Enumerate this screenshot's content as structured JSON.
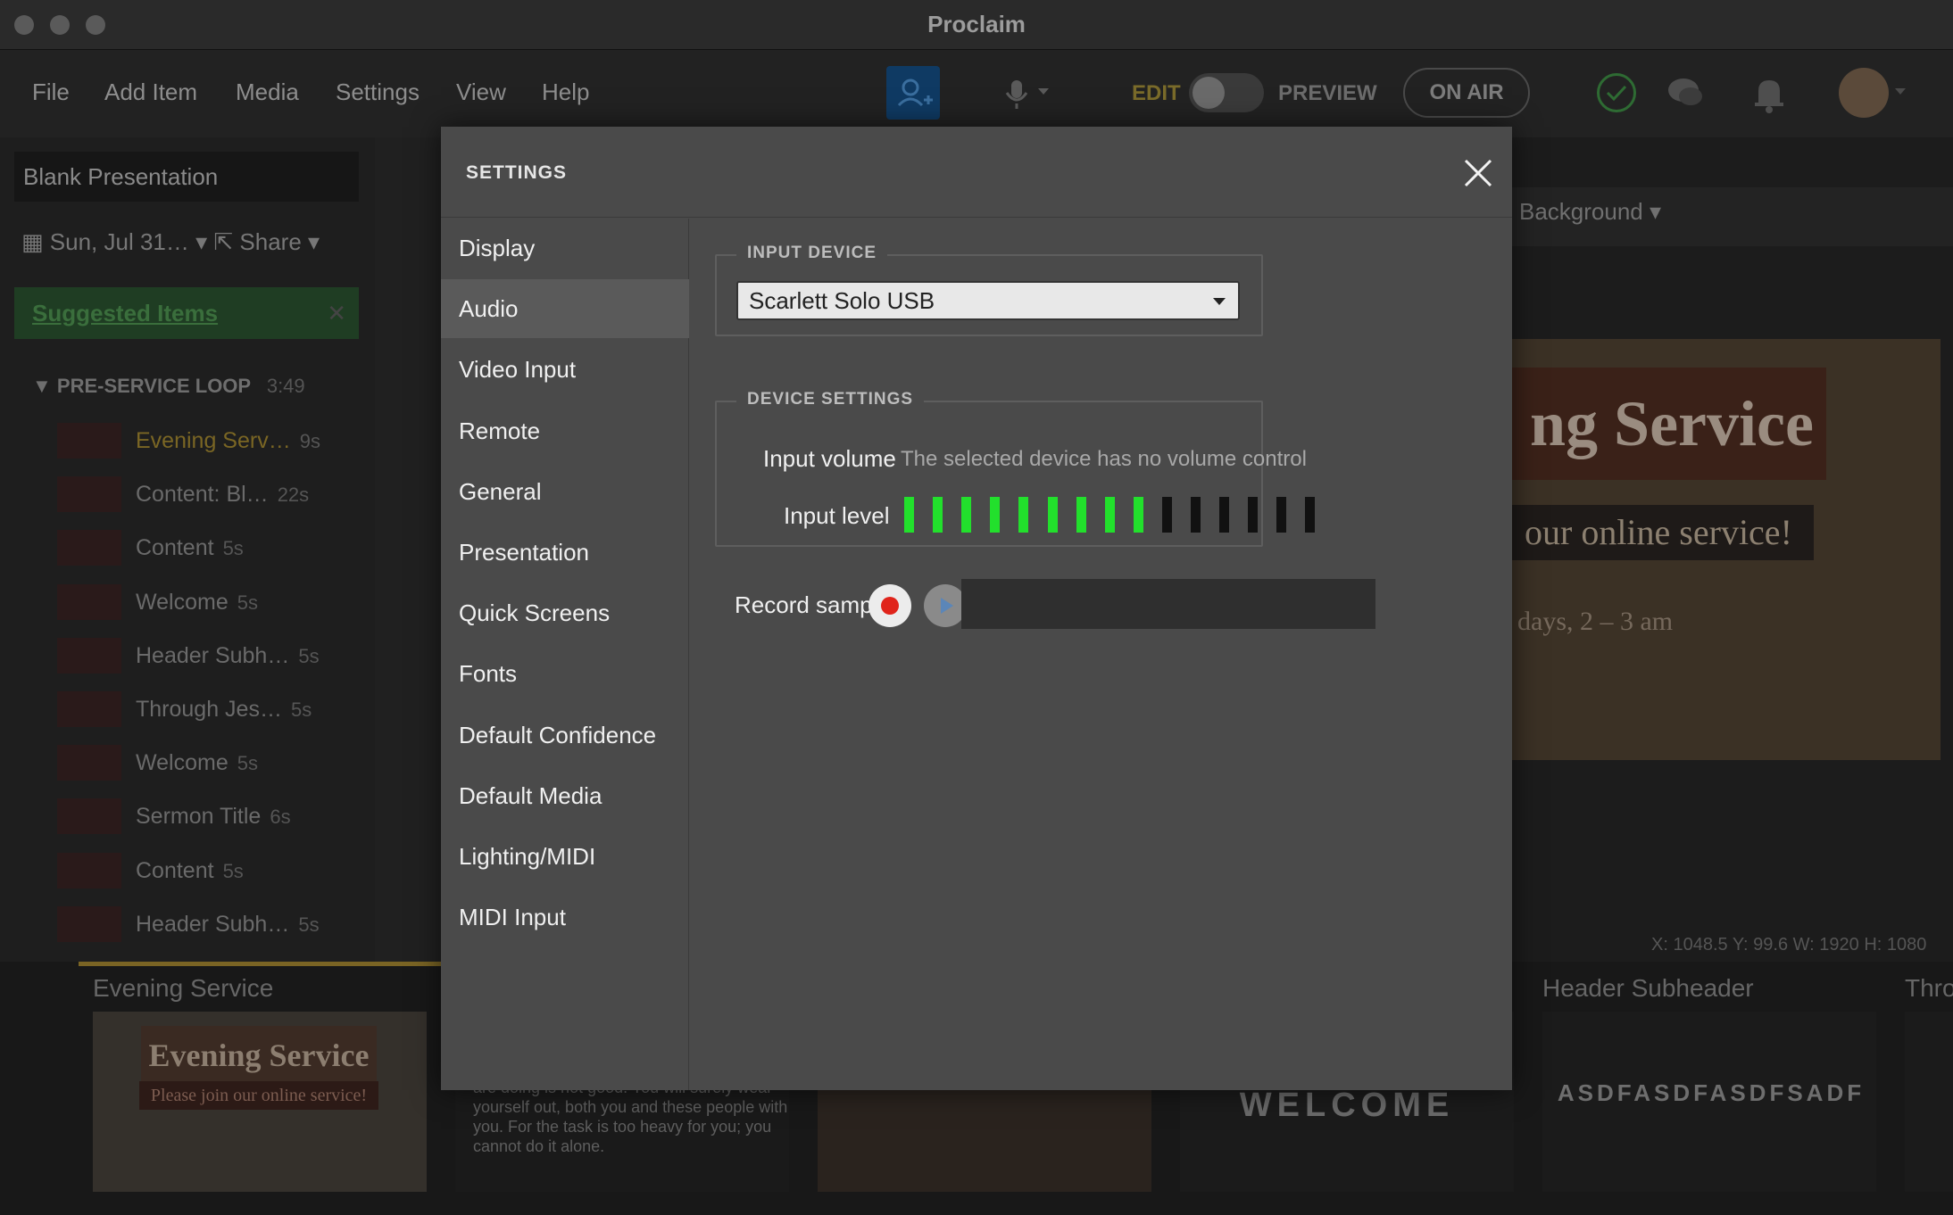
{
  "window": {
    "title": "Proclaim"
  },
  "menu": {
    "items": [
      "File",
      "Add Item",
      "Media",
      "Settings",
      "View",
      "Help"
    ],
    "edit_label": "EDIT",
    "preview_label": "PREVIEW",
    "onair_label": "ON AIR"
  },
  "background": {
    "presentation_name": "Blank Presentation",
    "date": "Sun, Jul 31…",
    "share": "Share",
    "suggested": "Suggested Items",
    "loop_title": "PRE-SERVICE LOOP",
    "loop_duration": "3:49",
    "items": [
      {
        "label": "Evening Serv…",
        "dur": "9s",
        "active": true
      },
      {
        "label": "Content: Bl…",
        "dur": "22s"
      },
      {
        "label": "Content",
        "dur": "5s"
      },
      {
        "label": "Welcome",
        "dur": "5s"
      },
      {
        "label": "Header Subh…",
        "dur": "5s"
      },
      {
        "label": "Through Jes…",
        "dur": "5s"
      },
      {
        "label": "Welcome",
        "dur": "5s"
      },
      {
        "label": "Sermon Title",
        "dur": "6s"
      },
      {
        "label": "Content",
        "dur": "5s"
      },
      {
        "label": "Header Subh…",
        "dur": "5s"
      }
    ],
    "toolbar_background": "Background",
    "preview_title": "ng Service",
    "preview_sub": "our online service!",
    "preview_day": "days, 2 – 3 am",
    "coords": "X: 1048.5  Y: 99.6   W: 1920  H: 1080",
    "filmstrip": [
      {
        "label": "Evening Service"
      },
      {
        "label": "Header Subheader"
      },
      {
        "label": "Thro"
      }
    ],
    "thumb_title": "Evening Service",
    "thumb_sub": "Please join our online service!",
    "thumb_body": "are doing is not good. You will surely wear yourself out, both you and these people with you. For the task is too heavy for you; you cannot do it alone.",
    "thumb_welcome": "WELCOME",
    "thumb_asdf": "ASDFASDFASDFSADF"
  },
  "settings": {
    "title": "SETTINGS",
    "nav": [
      "Display",
      "Audio",
      "Video Input",
      "Remote",
      "General",
      "Presentation",
      "Quick Screens",
      "Fonts",
      "Default Confidence",
      "Default Media",
      "Lighting/MIDI",
      "MIDI Input"
    ],
    "active_nav": "Audio",
    "input_device": {
      "legend": "INPUT DEVICE",
      "selected": "Scarlett Solo USB"
    },
    "device_settings": {
      "legend": "DEVICE SETTINGS",
      "input_volume_label": "Input volume",
      "input_volume_note": "The selected device has no volume control",
      "input_level_label": "Input level",
      "level_segments_total": 15,
      "level_segments_lit": 9
    },
    "record_sample_label": "Record sample",
    "colors": {
      "meter_on": "#22e02c",
      "meter_off": "#111111",
      "record": "#e0241b"
    }
  }
}
